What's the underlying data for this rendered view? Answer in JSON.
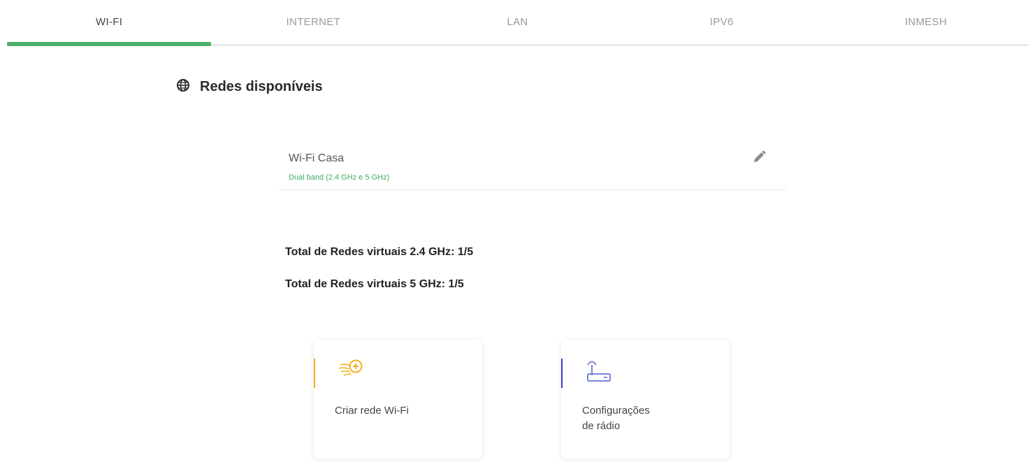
{
  "tabs": [
    {
      "label": "WI-FI",
      "active": true
    },
    {
      "label": "INTERNET",
      "active": false
    },
    {
      "label": "LAN",
      "active": false
    },
    {
      "label": "IPV6",
      "active": false
    },
    {
      "label": "INMESH",
      "active": false
    }
  ],
  "section": {
    "icon": "globe-icon",
    "title": "Redes disponíveis"
  },
  "networks": [
    {
      "name": "Wi-Fi Casa",
      "band": "Dual band (2.4 GHz e 5 GHz)",
      "action_icon": "pencil-icon"
    }
  ],
  "totals": {
    "ghz24": "Total de Redes virtuais 2.4 GHz: 1/5",
    "ghz5": "Total de Redes virtuais 5 GHz: 1/5"
  },
  "cards": {
    "create": {
      "label": "Criar rede Wi-Fi",
      "icon": "wifi-add-icon"
    },
    "radio": {
      "label": "Configurações\nde rádio",
      "icon": "router-icon"
    }
  },
  "colors": {
    "active_tab_underline": "#4caf6a",
    "band_text": "#3fae5f",
    "create_accent": "#f2b21f",
    "radio_accent": "#3a3ac2",
    "radio_icon": "#7a86d6"
  }
}
